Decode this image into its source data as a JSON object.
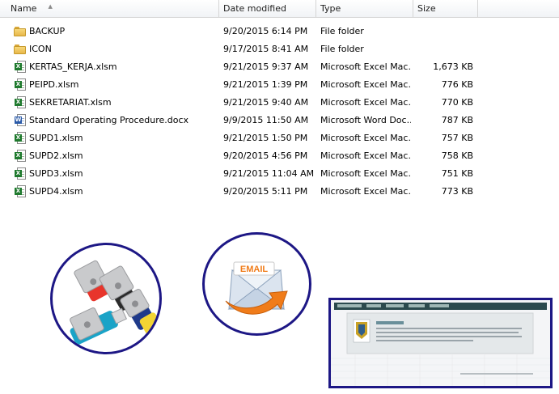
{
  "columns": {
    "name": "Name",
    "date": "Date modified",
    "type": "Type",
    "size": "Size"
  },
  "files": [
    {
      "icon": "folder-icon",
      "name": "BACKUP",
      "date": "9/20/2015 6:14 PM",
      "type": "File folder",
      "size": ""
    },
    {
      "icon": "folder-icon",
      "name": "ICON",
      "date": "9/17/2015 8:41 AM",
      "type": "File folder",
      "size": ""
    },
    {
      "icon": "excel-file-icon",
      "name": "KERTAS_KERJA.xlsm",
      "date": "9/21/2015 9:37 AM",
      "type": "Microsoft Excel Mac...",
      "size": "1,673 KB"
    },
    {
      "icon": "excel-file-icon",
      "name": "PEIPD.xlsm",
      "date": "9/21/2015 1:39 PM",
      "type": "Microsoft Excel Mac...",
      "size": "776 KB"
    },
    {
      "icon": "excel-file-icon",
      "name": "SEKRETARIAT.xlsm",
      "date": "9/21/2015 9:40 AM",
      "type": "Microsoft Excel Mac...",
      "size": "770 KB"
    },
    {
      "icon": "word-file-icon",
      "name": "Standard Operating Procedure.docx",
      "date": "9/9/2015 11:50 AM",
      "type": "Microsoft Word Doc...",
      "size": "787 KB"
    },
    {
      "icon": "excel-file-icon",
      "name": "SUPD1.xlsm",
      "date": "9/21/2015 1:50 PM",
      "type": "Microsoft Excel Mac...",
      "size": "757 KB"
    },
    {
      "icon": "excel-file-icon",
      "name": "SUPD2.xlsm",
      "date": "9/20/2015 4:56 PM",
      "type": "Microsoft Excel Mac...",
      "size": "758 KB"
    },
    {
      "icon": "excel-file-icon",
      "name": "SUPD3.xlsm",
      "date": "9/21/2015 11:04 AM",
      "type": "Microsoft Excel Mac...",
      "size": "751 KB"
    },
    {
      "icon": "excel-file-icon",
      "name": "SUPD4.xlsm",
      "date": "9/20/2015 5:11 PM",
      "type": "Microsoft Excel Mac...",
      "size": "773 KB"
    }
  ],
  "illustrations": {
    "email_label": "EMAIL",
    "usb_colors": [
      "#e8352b",
      "#2b2b2b",
      "#1f3a8a",
      "#f2d433",
      "#1aa3c7",
      "#a9aaad"
    ],
    "frame_color": "#1d1785",
    "email_arrow_color": "#f07c1a"
  }
}
